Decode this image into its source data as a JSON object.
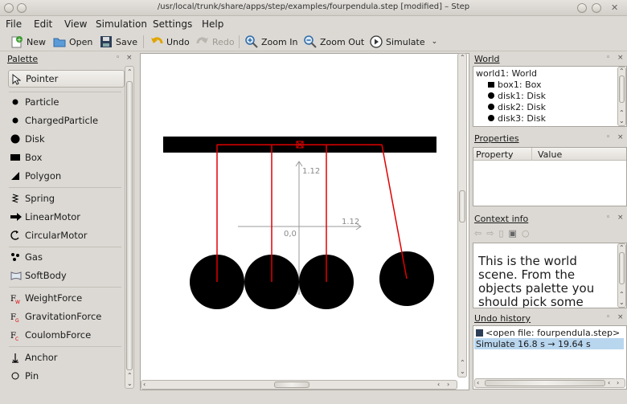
{
  "window": {
    "title": "/usr/local/trunk/share/apps/step/examples/fourpendula.step [modified] – Step"
  },
  "menu": [
    "File",
    "Edit",
    "View",
    "Simulation",
    "Settings",
    "Help"
  ],
  "toolbar": {
    "new": "New",
    "open": "Open",
    "save": "Save",
    "undo": "Undo",
    "redo": "Redo",
    "zoom_in": "Zoom In",
    "zoom_out": "Zoom Out",
    "simulate": "Simulate"
  },
  "palette": {
    "title": "Palette",
    "items": [
      {
        "label": "Pointer",
        "icon": "pointer-icon"
      },
      {
        "label": "Particle",
        "icon": "particle-icon"
      },
      {
        "label": "ChargedParticle",
        "icon": "charged-particle-icon"
      },
      {
        "label": "Disk",
        "icon": "disk-icon"
      },
      {
        "label": "Box",
        "icon": "box-icon"
      },
      {
        "label": "Polygon",
        "icon": "polygon-icon"
      },
      {
        "label": "Spring",
        "icon": "spring-icon"
      },
      {
        "label": "LinearMotor",
        "icon": "linear-motor-icon"
      },
      {
        "label": "CircularMotor",
        "icon": "circular-motor-icon"
      },
      {
        "label": "Gas",
        "icon": "gas-icon"
      },
      {
        "label": "SoftBody",
        "icon": "softbody-icon"
      },
      {
        "label": "WeightForce",
        "icon": "weight-force-icon"
      },
      {
        "label": "GravitationForce",
        "icon": "gravitation-force-icon"
      },
      {
        "label": "CoulombForce",
        "icon": "coulomb-force-icon"
      },
      {
        "label": "Anchor",
        "icon": "anchor-icon"
      },
      {
        "label": "Pin",
        "icon": "pin-icon"
      }
    ]
  },
  "scene": {
    "axis_y_label": "1.12",
    "axis_x_label": "1.12",
    "origin_label": "0,0",
    "colors": {
      "rod": "#e00000",
      "body": "#000000",
      "axis": "#9a9a9a"
    }
  },
  "world": {
    "title": "World",
    "items": [
      {
        "label": "world1: World",
        "icon": ""
      },
      {
        "label": "box1: Box",
        "icon": "box-icon"
      },
      {
        "label": "disk1: Disk",
        "icon": "disk-icon"
      },
      {
        "label": "disk2: Disk",
        "icon": "disk-icon"
      },
      {
        "label": "disk3: Disk",
        "icon": "disk-icon"
      }
    ]
  },
  "properties": {
    "title": "Properties",
    "col_property": "Property",
    "col_value": "Value"
  },
  "context_info": {
    "title": "Context info",
    "text": "This is the world scene. From the objects palette you should pick some"
  },
  "undo_history": {
    "title": "Undo history",
    "items": [
      {
        "label": "<open file: fourpendula.step>",
        "selected": false
      },
      {
        "label": "Simulate 16.8 s → 19.64 s",
        "selected": true
      }
    ]
  }
}
